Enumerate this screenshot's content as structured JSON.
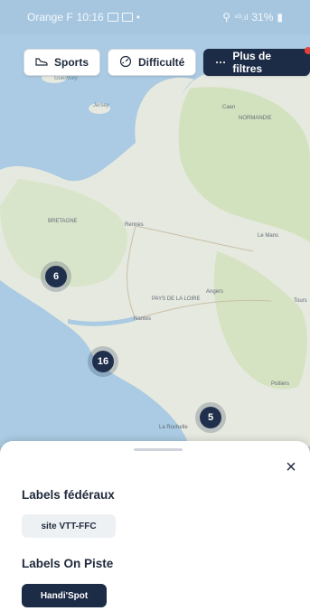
{
  "status_bar": {
    "carrier": "Orange F",
    "time": "10:16",
    "icons_left": [
      "gallery-icon",
      "notification-icon",
      "dot"
    ],
    "icons_right": [
      "location-icon",
      "4g-icon",
      "signal-icon"
    ],
    "battery": "31%"
  },
  "filters": {
    "sports": "Sports",
    "difficulty": "Difficulté",
    "more": "Plus de filtres",
    "more_icon": "···"
  },
  "map": {
    "labels": {
      "guernsey": "Guernsey",
      "jersey": "Jersey",
      "caen": "Caen",
      "normandie": "NORMANDIE",
      "bretagne": "BRETAGNE",
      "rennes": "Rennes",
      "le_mans": "Le Mans",
      "pays_loire": "PAYS DE LA LOIRE",
      "angers": "Angers",
      "tours": "Tours",
      "nantes": "Nantes",
      "poitiers": "Poitiers",
      "la_rochelle": "La Rochelle"
    },
    "clusters": [
      {
        "count": "6"
      },
      {
        "count": "16"
      },
      {
        "count": "5"
      }
    ]
  },
  "sheet": {
    "close": "×",
    "section_federal": "Labels fédéraux",
    "tag_federal": "site VTT-FFC",
    "section_onpiste": "Labels On Piste",
    "tag_onpiste": "Handi'Spot"
  },
  "colors": {
    "accent": "#1c2b46",
    "notification": "#e5413c",
    "sea": "#aacbe3",
    "land": "#e6e9df"
  }
}
